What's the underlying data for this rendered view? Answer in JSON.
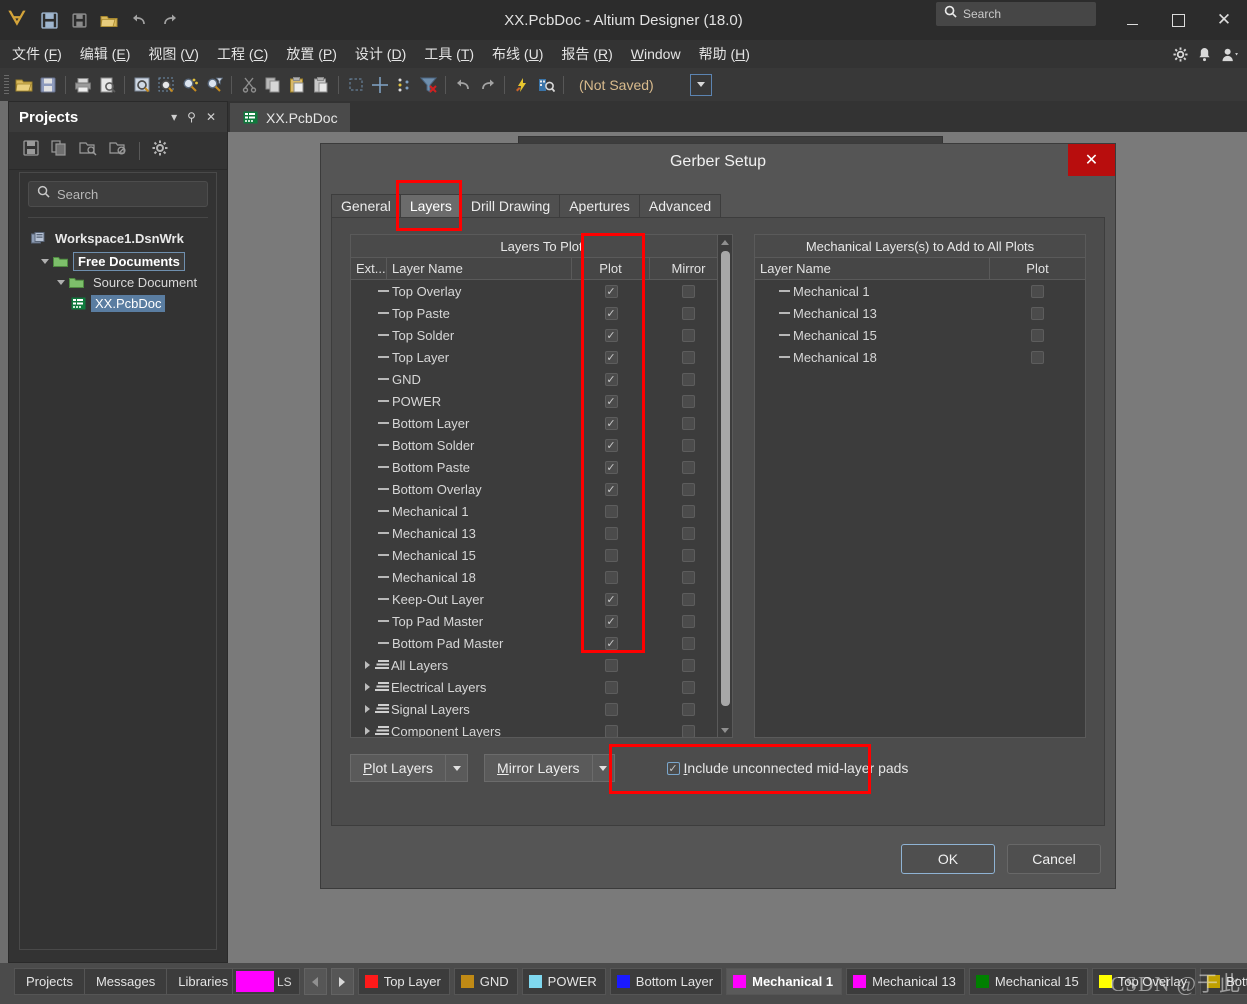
{
  "titlebar": {
    "title": "XX.PcbDoc - Altium Designer (18.0)",
    "search_placeholder": "Search",
    "logo": "altium-logo",
    "quick_icons": [
      "save-icon",
      "save-all-icon",
      "open-icon",
      "undo-icon",
      "redo-icon"
    ],
    "minimize": "",
    "maximize": "",
    "close": "✕"
  },
  "menubar": {
    "items": [
      {
        "label": "文件 (",
        "key": "F",
        "tail": ")"
      },
      {
        "label": "编辑 (",
        "key": "E",
        "tail": ")"
      },
      {
        "label": "视图 (",
        "key": "V",
        "tail": ")"
      },
      {
        "label": "工程 (",
        "key": "C",
        "tail": ")"
      },
      {
        "label": "放置 (",
        "key": "P",
        "tail": ")"
      },
      {
        "label": "设计 (",
        "key": "D",
        "tail": ")"
      },
      {
        "label": "工具 (",
        "key": "T",
        "tail": ")"
      },
      {
        "label": "布线 (",
        "key": "U",
        "tail": ")"
      },
      {
        "label": "报告 (",
        "key": "R",
        "tail": ")"
      },
      {
        "label": "",
        "key": "W",
        "tail": "indow"
      },
      {
        "label": "帮助 (",
        "key": "H",
        "tail": ")"
      }
    ],
    "right_icons": [
      "gear-icon",
      "bell-icon",
      "user-icon"
    ]
  },
  "toolbar": {
    "not_saved": "(Not Saved)",
    "icons": [
      "open-folder-icon",
      "save-icon",
      "print-icon",
      "print-preview-icon",
      "zoom-page-icon",
      "zoom-area-icon",
      "zoom-select-icon",
      "zoom-filter-icon",
      "cut-icon",
      "copy-icon",
      "paste-icon",
      "paste-special-icon",
      "select-area-icon",
      "crosshair-icon",
      "net-icon",
      "clear-filter-icon",
      "undo-icon",
      "redo-icon",
      "wizard-icon",
      "inspect-icon"
    ]
  },
  "projects_panel": {
    "title": "Projects",
    "header_buttons": [
      "chevron-down-icon",
      "pin-icon",
      "close-icon"
    ],
    "tool_icons": [
      "save-icon",
      "copy-project-icon",
      "open-project-icon",
      "close-project-icon",
      "gear-icon"
    ],
    "search_placeholder": "Search",
    "tree": [
      {
        "label": "Workspace1.DsnWrk",
        "icon": "workspace-icon",
        "indent": 0,
        "style": "root",
        "expander": false
      },
      {
        "label": "Free Documents",
        "icon": "folder-icon",
        "indent": 1,
        "style": "sel-box",
        "expander": true
      },
      {
        "label": "Source Document",
        "icon": "folder-icon",
        "indent": 2,
        "style": "normal",
        "expander": true
      },
      {
        "label": "XX.PcbDoc",
        "icon": "pcb-icon",
        "indent": 3,
        "style": "sel-fill",
        "expander": false
      }
    ]
  },
  "document_tabs": [
    {
      "label": "XX.PcbDoc",
      "icon": "pcb-icon",
      "active": true
    }
  ],
  "dialog": {
    "title": "Gerber Setup",
    "close_label": "✕",
    "tabs": [
      {
        "label": "General",
        "active": false
      },
      {
        "label": "Layers",
        "active": true
      },
      {
        "label": "Drill Drawing",
        "active": false
      },
      {
        "label": "Apertures",
        "active": false
      },
      {
        "label": "Advanced",
        "active": false
      }
    ],
    "left_list": {
      "caption": "Layers To Plot",
      "columns": [
        "Ext...",
        "Layer Name",
        "Plot",
        "Mirror"
      ],
      "rows": [
        {
          "name": "Top Overlay",
          "type": "layer",
          "plot": true,
          "mirror": false
        },
        {
          "name": "Top Paste",
          "type": "layer",
          "plot": true,
          "mirror": false
        },
        {
          "name": "Top Solder",
          "type": "layer",
          "plot": true,
          "mirror": false
        },
        {
          "name": "Top Layer",
          "type": "layer",
          "plot": true,
          "mirror": false
        },
        {
          "name": "GND",
          "type": "layer",
          "plot": true,
          "mirror": false
        },
        {
          "name": "POWER",
          "type": "layer",
          "plot": true,
          "mirror": false
        },
        {
          "name": "Bottom Layer",
          "type": "layer",
          "plot": true,
          "mirror": false
        },
        {
          "name": "Bottom Solder",
          "type": "layer",
          "plot": true,
          "mirror": false
        },
        {
          "name": "Bottom Paste",
          "type": "layer",
          "plot": true,
          "mirror": false
        },
        {
          "name": "Bottom Overlay",
          "type": "layer",
          "plot": true,
          "mirror": false
        },
        {
          "name": "Mechanical 1",
          "type": "layer",
          "plot": false,
          "mirror": false
        },
        {
          "name": "Mechanical 13",
          "type": "layer",
          "plot": false,
          "mirror": false
        },
        {
          "name": "Mechanical 15",
          "type": "layer",
          "plot": false,
          "mirror": false
        },
        {
          "name": "Mechanical 18",
          "type": "layer",
          "plot": false,
          "mirror": false
        },
        {
          "name": "Keep-Out Layer",
          "type": "layer",
          "plot": true,
          "mirror": false
        },
        {
          "name": "Top Pad Master",
          "type": "layer",
          "plot": true,
          "mirror": false
        },
        {
          "name": "Bottom Pad Master",
          "type": "layer",
          "plot": true,
          "mirror": false
        },
        {
          "name": "All Layers",
          "type": "group",
          "plot": false,
          "mirror": false
        },
        {
          "name": "Electrical Layers",
          "type": "group",
          "plot": false,
          "mirror": false
        },
        {
          "name": "Signal Layers",
          "type": "group",
          "plot": false,
          "mirror": false
        },
        {
          "name": "Component Layers",
          "type": "group",
          "plot": false,
          "mirror": false
        }
      ]
    },
    "right_list": {
      "caption": "Mechanical Layers(s) to Add to All Plots",
      "columns": [
        "Layer Name",
        "Plot"
      ],
      "rows": [
        {
          "name": "Mechanical 1",
          "plot": false
        },
        {
          "name": "Mechanical 13",
          "plot": false
        },
        {
          "name": "Mechanical 15",
          "plot": false
        },
        {
          "name": "Mechanical 18",
          "plot": false
        }
      ]
    },
    "plot_layers_button": {
      "label_pre": "P",
      "label_key": "P",
      "label": "Plot Layers"
    },
    "mirror_layers_button": {
      "label": "Mirror Layers"
    },
    "include_checkbox": {
      "label": "Include unconnected mid-layer pads",
      "checked": true
    },
    "ok_label": "OK",
    "cancel_label": "Cancel"
  },
  "statusbar": {
    "tabs": [
      "Projects",
      "Messages",
      "Libraries"
    ],
    "ls_label": "LS",
    "ls_color": "#ff00ff",
    "nav_prev": "prev-layer-icon",
    "nav_next": "next-layer-icon",
    "layer_tabs": [
      {
        "label": "Top Layer",
        "color": "#ff1a1a",
        "active": false
      },
      {
        "label": "GND",
        "color": "#c08a15",
        "active": false
      },
      {
        "label": "POWER",
        "color": "#7fd8ef",
        "active": false
      },
      {
        "label": "Bottom Layer",
        "color": "#1a1aff",
        "active": false
      },
      {
        "label": "Mechanical 1",
        "color": "#ff00ff",
        "active": true
      },
      {
        "label": "Mechanical 13",
        "color": "#ff00ff",
        "active": false
      },
      {
        "label": "Mechanical 15",
        "color": "#008000",
        "active": false
      },
      {
        "label": "Top Overlay",
        "color": "#ffff00",
        "active": false
      },
      {
        "label": "Bottom Overl",
        "color": "#c0a000",
        "active": false
      }
    ],
    "watermark": "CSDN @于此"
  }
}
